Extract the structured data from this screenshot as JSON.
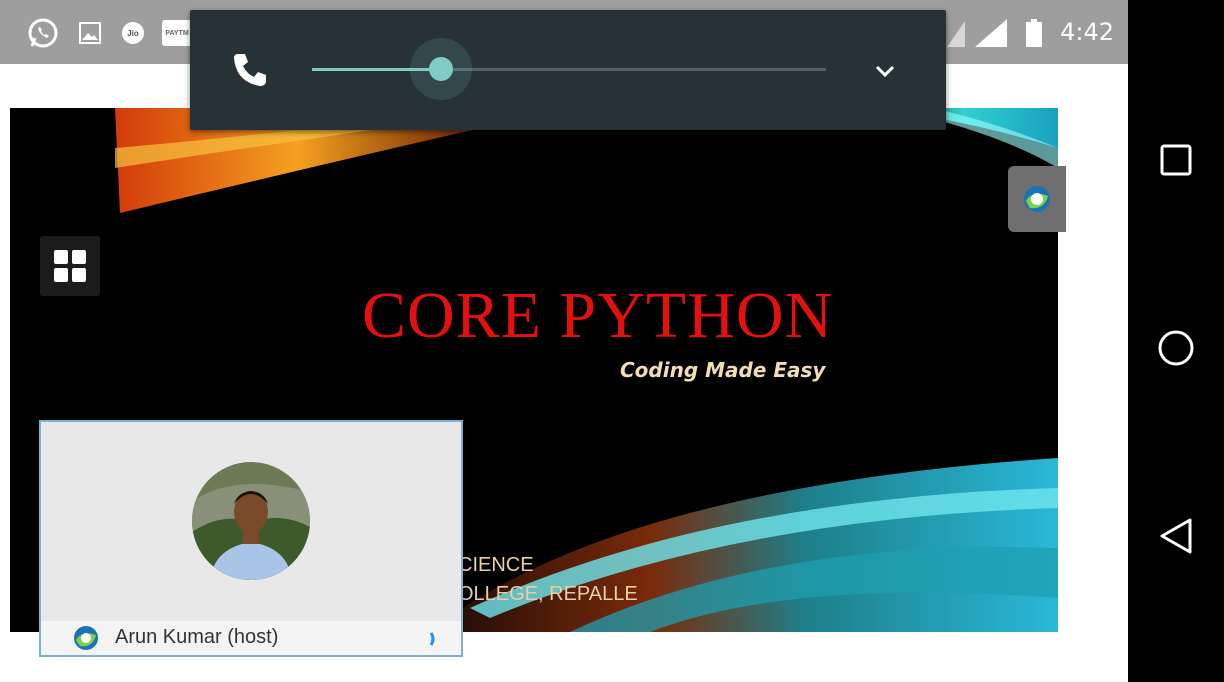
{
  "status_bar": {
    "time": "4:42",
    "icons": [
      "whatsapp-icon",
      "gallery-icon",
      "jio-icon",
      "paytm-icon",
      "signal-icon",
      "signal-icon",
      "battery-icon"
    ],
    "paytm_label": "PAYTM",
    "jio_label": "Jio"
  },
  "volume": {
    "icon": "phone-icon",
    "level": 0.25,
    "expand_icon": "chevron-down-icon"
  },
  "slide": {
    "title": "CORE PYTHON",
    "subtitle": "Coding Made Easy",
    "line1": "CIENCE",
    "line2": "OLLEGE, REPALLE",
    "colors": {
      "title": "#e41010",
      "subtitle": "#f1dfb2"
    }
  },
  "participant": {
    "name": "Arun Kumar (host)",
    "logo": "webex-logo-icon",
    "audio_icon": "audio-active-icon"
  },
  "nav": {
    "buttons": [
      "recents-square-icon",
      "home-circle-icon",
      "back-triangle-icon"
    ]
  }
}
